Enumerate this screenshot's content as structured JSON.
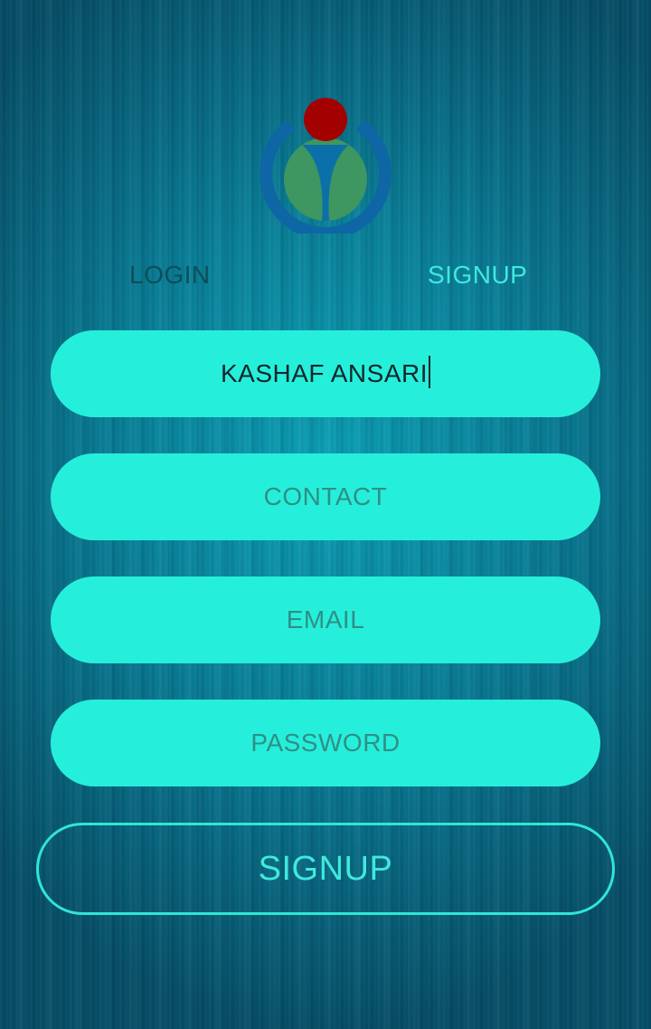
{
  "tabs": {
    "login_label": "LOGIN",
    "signup_label": "SIGNUP",
    "active": "SIGNUP"
  },
  "form": {
    "name_value": "KASHAF ANSARI",
    "contact_placeholder": "CONTACT",
    "email_placeholder": "EMAIL",
    "password_placeholder": "PASSWORD"
  },
  "submit": {
    "label": "SIGNUP"
  },
  "colors": {
    "field_background": "#25efdb",
    "accent": "#3fe9dc",
    "inactive_tab": "#0b4f57",
    "logo_red": "#a30000",
    "logo_green": "#3e9660",
    "logo_blue": "#0e67a4"
  },
  "icons": {
    "logo": "wikimedia-logo-icon"
  }
}
